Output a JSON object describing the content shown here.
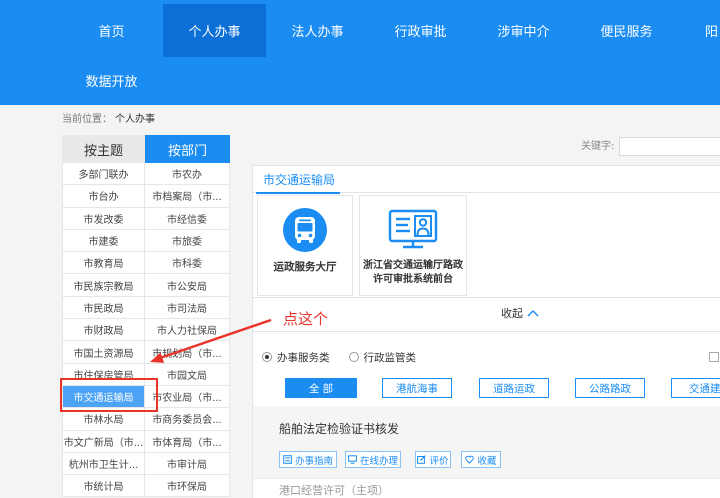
{
  "colors": {
    "nav_bg": "#1a8cf2",
    "nav_active_bg": "#0b6fd6",
    "accent": "#1a8cf2",
    "selected_bg": "#4da3f6",
    "annotation": "#e8352b"
  },
  "nav": {
    "items": [
      {
        "label": "首页"
      },
      {
        "label": "个人办事",
        "active": true
      },
      {
        "label": "法人办事"
      },
      {
        "label": "行政审批"
      },
      {
        "label": "涉审中介"
      },
      {
        "label": "便民服务"
      },
      {
        "label": "阳"
      }
    ],
    "second_row": [
      {
        "label": "数据开放"
      }
    ]
  },
  "breadcrumb": {
    "label": "当前位置：",
    "current": "个人办事"
  },
  "sidebar": {
    "tabs": [
      {
        "label": "按主题",
        "active": false
      },
      {
        "label": "按部门",
        "active": true
      }
    ],
    "departments": [
      {
        "name": "多部门联办"
      },
      {
        "name": "市农办"
      },
      {
        "name": "市台办"
      },
      {
        "name": "市档案局（市..."
      },
      {
        "name": "市发改委"
      },
      {
        "name": "市经信委"
      },
      {
        "name": "市建委"
      },
      {
        "name": "市旅委"
      },
      {
        "name": "市教育局"
      },
      {
        "name": "市科委"
      },
      {
        "name": "市民族宗教局"
      },
      {
        "name": "市公安局"
      },
      {
        "name": "市民政局"
      },
      {
        "name": "市司法局"
      },
      {
        "name": "市财政局"
      },
      {
        "name": "市人力社保局"
      },
      {
        "name": "市国土资源局"
      },
      {
        "name": "市规划局（市..."
      },
      {
        "name": "市住保房管局"
      },
      {
        "name": "市园文局"
      },
      {
        "name": "市交通运输局",
        "selected": true
      },
      {
        "name": "市农业局（市..."
      },
      {
        "name": "市林水局"
      },
      {
        "name": "市商务委员会..."
      },
      {
        "name": "市文广新局（市..."
      },
      {
        "name": "市体育局（市..."
      },
      {
        "name": "杭州市卫生计..."
      },
      {
        "name": "市审计局"
      },
      {
        "name": "市统计局"
      },
      {
        "name": "市环保局"
      }
    ]
  },
  "search": {
    "label": "关键字:",
    "value": ""
  },
  "panel": {
    "tab_label": "市交通运输局",
    "apps": [
      {
        "icon": "bus-icon",
        "label": "运政服务大厅"
      },
      {
        "icon": "monitor-user-icon",
        "label_lines": [
          "浙江省交通运输厅路政",
          "许可审批系统前台"
        ]
      }
    ],
    "collapse": {
      "label": "收起",
      "icon": "chevron-up-icon"
    },
    "filter": {
      "types": [
        {
          "label": "办事服务类",
          "checked": true
        },
        {
          "label": "行政监管类",
          "checked": false
        }
      ],
      "categories": [
        {
          "label": "全 部",
          "active": true
        },
        {
          "label": "港航海事",
          "active": false
        },
        {
          "label": "道路运政",
          "active": false
        },
        {
          "label": "公路路政",
          "active": false
        },
        {
          "label": "交通建设",
          "active": false
        }
      ]
    },
    "items": [
      {
        "title": "船舶法定检验证书核发",
        "actions": [
          {
            "label": "办事指南",
            "icon": "guide-doc-icon"
          },
          {
            "label": "在线办理",
            "icon": "online-monitor-icon"
          },
          {
            "label": "评价",
            "icon": "evaluate-edit-icon"
          },
          {
            "label": "收藏",
            "icon": "heart-icon"
          }
        ]
      },
      {
        "title": "港口经营许可（主项）"
      }
    ]
  },
  "annotation": {
    "text": "点这个"
  }
}
